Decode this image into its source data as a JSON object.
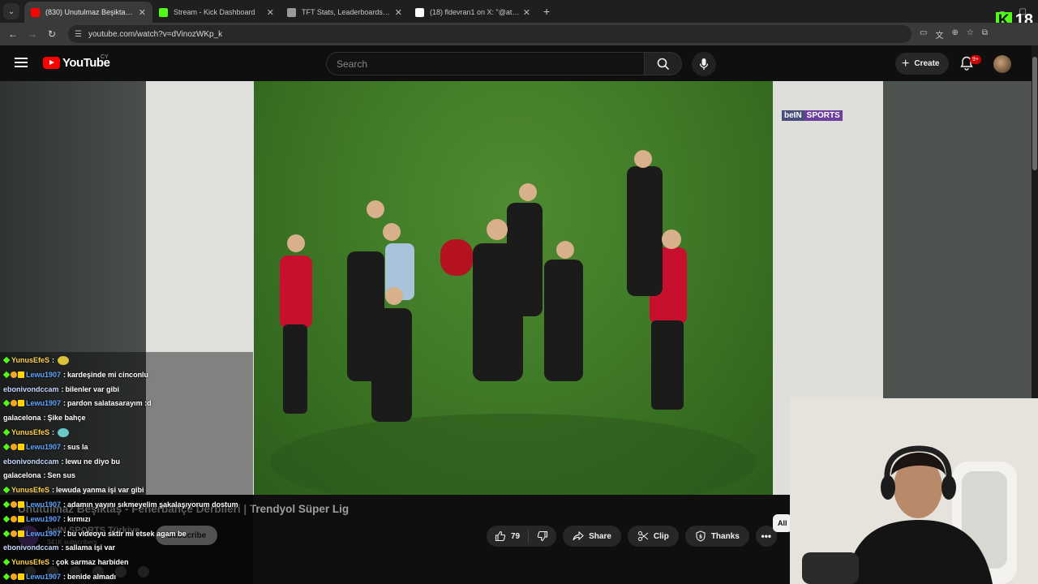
{
  "browser": {
    "tabs": [
      {
        "label": "(830) Unutulmaz Beşiktaş - Fen",
        "favicon_color": "#ff0000",
        "active": true
      },
      {
        "label": "Stream - Kick Dashboard",
        "favicon_color": "#53fc18",
        "active": false
      },
      {
        "label": "TFT Stats, Leaderboards, League",
        "favicon_color": "#9a9a9a",
        "active": false
      },
      {
        "label": "(18) fldevran1 on X: \"@atadog",
        "favicon_color": "#ffffff",
        "active": false
      }
    ],
    "new_tab": "+",
    "url": "youtube.com/watch?v=dVinozWKp_k",
    "kick_viewer_count": "18"
  },
  "youtube": {
    "logo_text": "YouTube",
    "country": "CY",
    "search_placeholder": "Search",
    "create_label": "Create",
    "notification_count": "9+"
  },
  "overlay": {
    "channel_watermark": "beIN",
    "channel_watermark_2": "SPORTS"
  },
  "video": {
    "title": "Unutulmaz Beşiktaş - Fenerbahçe Derbileri | Trendyol Süper Lig",
    "channel_name": "beIN SPORTS Türkiye",
    "subscribers": "341K subscribers",
    "subscribe_label": "Subscribe",
    "like_count": "79",
    "share_label": "Share",
    "clip_label": "Clip",
    "thanks_label": "Thanks",
    "chip_label": "All"
  },
  "chat": [
    {
      "user": "YunusEfeS",
      "text": "",
      "badges": [
        "green"
      ],
      "emote": "#d9c23a",
      "user_class": "u-yunus"
    },
    {
      "user": "Lewu1907",
      "text": "kardeşinde mi cinconlu",
      "badges": [
        "green",
        "gold",
        "yellow"
      ],
      "user_class": "u-lewu"
    },
    {
      "user": "ebonivondccam",
      "text": "bilenler var gibi",
      "badges": [],
      "user_class": "u-ebon"
    },
    {
      "user": "Lewu1907",
      "text": "pardon salatasarayım :d",
      "badges": [
        "green",
        "gold",
        "yellow"
      ],
      "user_class": "u-lewu"
    },
    {
      "user": "galacelona",
      "text": "Şike bahçe",
      "badges": [],
      "user_class": "u-gala"
    },
    {
      "user": "YunusEfeS",
      "text": "",
      "badges": [
        "green"
      ],
      "emote": "#6cc7c9",
      "user_class": "u-yunus"
    },
    {
      "user": "Lewu1907",
      "text": "sus la",
      "badges": [
        "green",
        "gold",
        "yellow"
      ],
      "user_class": "u-lewu"
    },
    {
      "user": "ebonivondccam",
      "text": "lewu ne diyo bu",
      "badges": [],
      "user_class": "u-ebon"
    },
    {
      "user": "galacelona",
      "text": "Sen sus",
      "badges": [],
      "user_class": "u-gala"
    },
    {
      "user": "YunusEfeS",
      "text": "lewuda yanma işi var gibi",
      "badges": [
        "green"
      ],
      "user_class": "u-yunus"
    },
    {
      "user": "Lewu1907",
      "text": "adamın yayını sıkmeyelim şakalaşıyorum dostum",
      "badges": [
        "green",
        "gold",
        "yellow"
      ],
      "user_class": "u-lewu"
    },
    {
      "user": "Lewu1907",
      "text": "kırmızı",
      "badges": [
        "green",
        "gold",
        "yellow"
      ],
      "user_class": "u-lewu"
    },
    {
      "user": "Lewu1907",
      "text": "bu videoyu sktir mi etsek agam be",
      "badges": [
        "green",
        "gold",
        "yellow"
      ],
      "user_class": "u-lewu"
    },
    {
      "user": "ebonivondccam",
      "text": "sallama işi var",
      "badges": [],
      "user_class": "u-ebon"
    },
    {
      "user": "YunusEfeS",
      "text": "çok sarmaz harbiden",
      "badges": [
        "green"
      ],
      "user_class": "u-yunus"
    },
    {
      "user": "Lewu1907",
      "text": "benide almadı",
      "badges": [
        "green",
        "gold",
        "yellow"
      ],
      "user_class": "u-lewu"
    }
  ]
}
